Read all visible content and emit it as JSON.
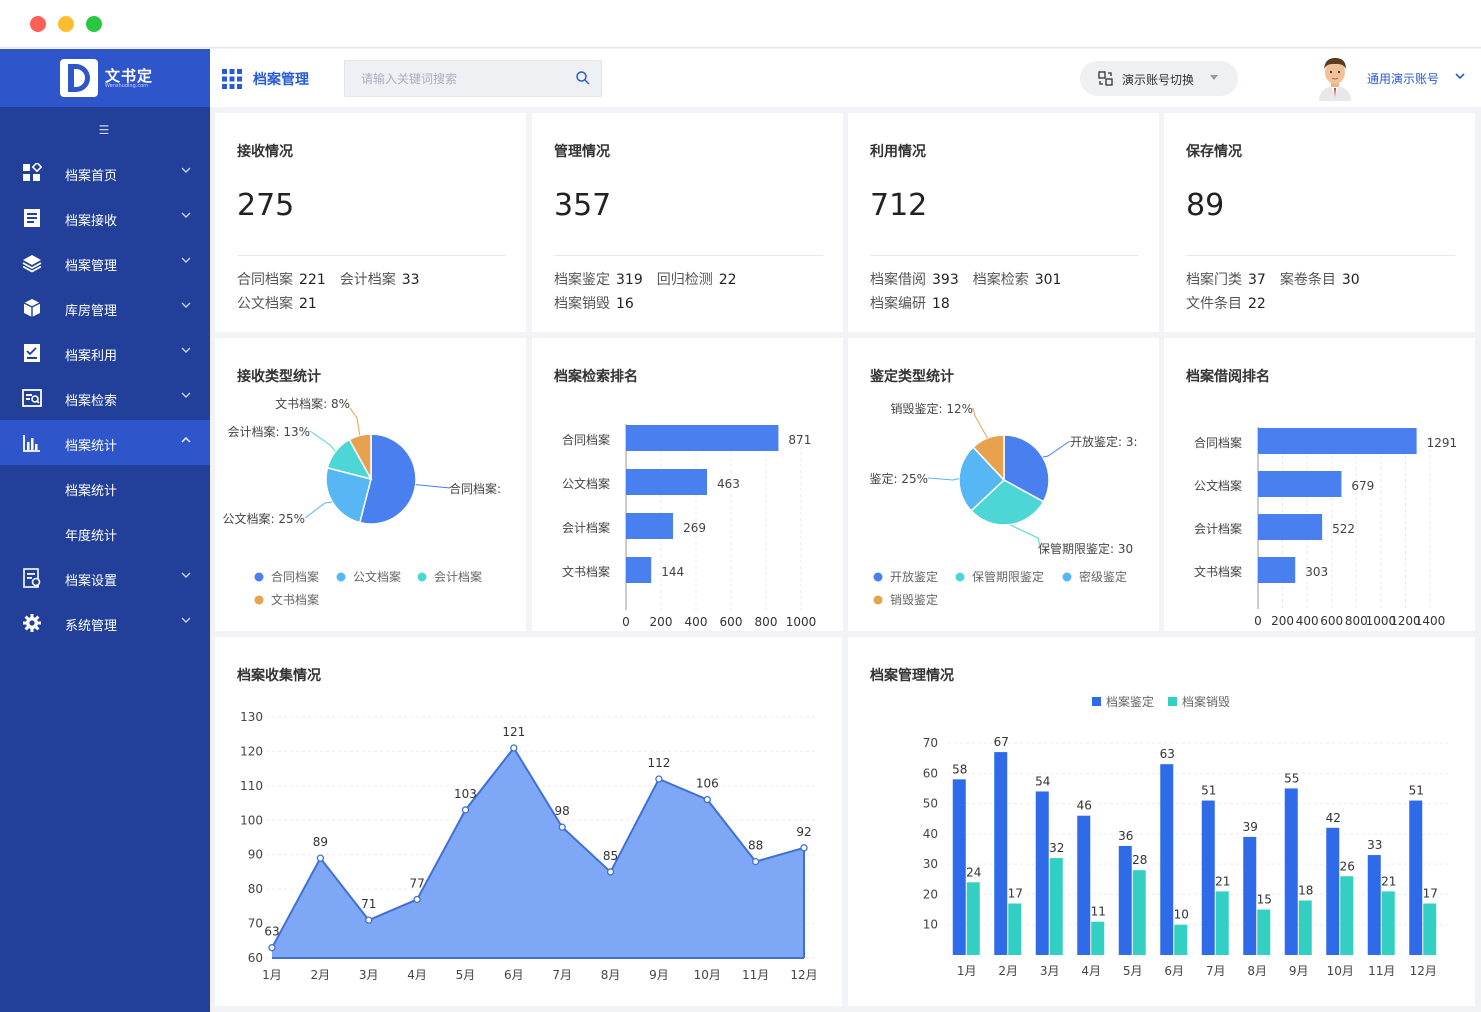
{
  "brand": {
    "name": "文书定",
    "sub": "Wenshuding.com"
  },
  "sidebar": {
    "items": [
      {
        "label": "档案首页",
        "icon": "grid-apps-icon"
      },
      {
        "label": "档案接收",
        "icon": "list-doc-icon"
      },
      {
        "label": "档案管理",
        "icon": "layers-icon"
      },
      {
        "label": "库房管理",
        "icon": "box-icon"
      },
      {
        "label": "档案利用",
        "icon": "checklist-icon"
      },
      {
        "label": "档案检索",
        "icon": "search-doc-icon"
      },
      {
        "label": "档案统计",
        "icon": "bar-chart-icon"
      },
      {
        "label": "档案设置",
        "icon": "settings-doc-icon"
      },
      {
        "label": "系统管理",
        "icon": "gear-icon"
      }
    ],
    "subitems": [
      {
        "label": "档案统计"
      },
      {
        "label": "年度统计"
      }
    ]
  },
  "header": {
    "title": "档案管理",
    "search_placeholder": "请输入关键词搜索",
    "account_switch": "演示账号切换",
    "user_name": "通用演示账号"
  },
  "summary": [
    {
      "title": "接收情况",
      "total": "275",
      "lines": [
        [
          [
            "合同档案",
            "221"
          ],
          [
            "会计档案",
            "33"
          ]
        ],
        [
          [
            "公文档案",
            "21"
          ]
        ]
      ]
    },
    {
      "title": "管理情况",
      "total": "357",
      "lines": [
        [
          [
            "档案鉴定",
            "319"
          ],
          [
            "回归检测",
            "22"
          ]
        ],
        [
          [
            "档案销毁",
            "16"
          ]
        ]
      ]
    },
    {
      "title": "利用情况",
      "total": "712",
      "lines": [
        [
          [
            "档案借阅",
            "393"
          ],
          [
            "档案检索",
            "301"
          ]
        ],
        [
          [
            "档案编研",
            "18"
          ]
        ]
      ]
    },
    {
      "title": "保存情况",
      "total": "89",
      "lines": [
        [
          [
            "档案门类",
            "37"
          ],
          [
            "案卷条目",
            "30"
          ]
        ],
        [
          [
            "文件条目",
            "22"
          ]
        ]
      ]
    }
  ],
  "colors": {
    "blue": "#4a7ff0",
    "light_blue": "#56b7f4",
    "cyan": "#4dd6d6",
    "orange": "#e8a14c",
    "dark_blue": "#2f6be8",
    "teal": "#33cfc3",
    "area": "#7ea7f5",
    "line": "#3f6fd8"
  },
  "chart_data": [
    {
      "id": "receive_type",
      "title": "接收类型统计",
      "type": "pie",
      "slices": [
        {
          "name": "合同档案",
          "value": 54,
          "label": "合同档案:"
        },
        {
          "name": "公文档案",
          "value": 25,
          "label": "公文档案: 25%"
        },
        {
          "name": "会计档案",
          "value": 13,
          "label": "会计档案: 13%"
        },
        {
          "name": "文书档案",
          "value": 8,
          "label": "文书档案: 8%"
        }
      ],
      "legend": [
        "合同档案",
        "公文档案",
        "会计档案",
        "文书档案"
      ]
    },
    {
      "id": "search_rank",
      "title": "档案检索排名",
      "type": "bar",
      "orientation": "horizontal",
      "categories": [
        "合同档案",
        "公文档案",
        "会计档案",
        "文书档案"
      ],
      "values": [
        871,
        463,
        269,
        144
      ],
      "xlim": [
        0,
        1000
      ],
      "ticks": [
        "0",
        "200",
        "400",
        "600",
        "800",
        "1000"
      ]
    },
    {
      "id": "appraisal_type",
      "title": "鉴定类型统计",
      "type": "pie",
      "slices": [
        {
          "name": "开放鉴定",
          "value": 33,
          "label": "开放鉴定: 3:"
        },
        {
          "name": "保管期限鉴定",
          "value": 30,
          "label": "保管期限鉴定: 30"
        },
        {
          "name": "密级鉴定",
          "value": 25,
          "label": "鉴定: 25%"
        },
        {
          "name": "销毁鉴定",
          "value": 12,
          "label": "销毁鉴定: 12%"
        }
      ],
      "legend": [
        "开放鉴定",
        "保管期限鉴定",
        "密级鉴定",
        "销毁鉴定"
      ]
    },
    {
      "id": "borrow_rank",
      "title": "档案借阅排名",
      "type": "bar",
      "orientation": "horizontal",
      "categories": [
        "合同档案",
        "公文档案",
        "会计档案",
        "文书档案"
      ],
      "values": [
        1291,
        679,
        522,
        303
      ],
      "xlim": [
        0,
        1400
      ],
      "ticks": [
        "0",
        "200",
        "400",
        "600",
        "800",
        "1000",
        "1200",
        "1400"
      ]
    },
    {
      "id": "collection",
      "title": "档案收集情况",
      "type": "area",
      "categories": [
        "1月",
        "2月",
        "3月",
        "4月",
        "5月",
        "6月",
        "7月",
        "8月",
        "9月",
        "10月",
        "11月",
        "12月"
      ],
      "values": [
        63,
        89,
        71,
        77,
        103,
        121,
        98,
        85,
        112,
        106,
        88,
        92
      ],
      "ylim": [
        60,
        130
      ],
      "yticks": [
        "60",
        "70",
        "80",
        "90",
        "100",
        "110",
        "120",
        "130"
      ]
    },
    {
      "id": "management",
      "title": "档案管理情况",
      "type": "bar",
      "categories": [
        "1月",
        "2月",
        "3月",
        "4月",
        "5月",
        "6月",
        "7月",
        "8月",
        "9月",
        "10月",
        "11月",
        "12月"
      ],
      "series": [
        {
          "name": "档案鉴定",
          "values": [
            58,
            67,
            54,
            46,
            36,
            63,
            51,
            39,
            55,
            42,
            33,
            51
          ]
        },
        {
          "name": "档案销毁",
          "values": [
            24,
            17,
            32,
            11,
            28,
            10,
            21,
            15,
            18,
            26,
            21,
            17
          ]
        }
      ],
      "ylim": [
        0,
        70
      ],
      "yticks": [
        "10",
        "20",
        "30",
        "40",
        "50",
        "60",
        "70"
      ],
      "legend_position": "top-center"
    }
  ]
}
